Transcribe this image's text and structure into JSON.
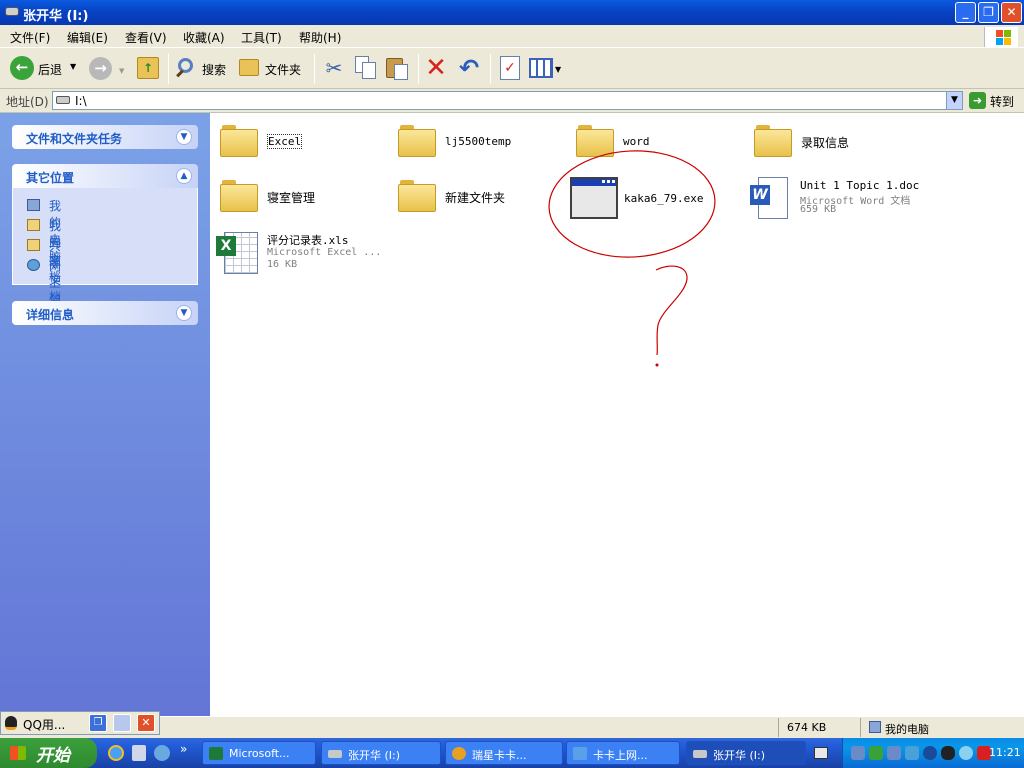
{
  "window": {
    "title": "张开华 (I:)"
  },
  "menu": [
    "文件(F)",
    "编辑(E)",
    "查看(V)",
    "收藏(A)",
    "工具(T)",
    "帮助(H)"
  ],
  "toolbar": {
    "back": "后退",
    "search": "搜索",
    "folders": "文件夹"
  },
  "address": {
    "label": "地址(D)",
    "value": "I:\\",
    "go": "转到"
  },
  "sidebar": {
    "tasks_title": "文件和文件夹任务",
    "other_title": "其它位置",
    "other_items": [
      "我的电脑",
      "我的文档",
      "共享文档",
      "网上邻居"
    ],
    "details_title": "详细信息"
  },
  "files": [
    {
      "name": "Excel",
      "type": "folder"
    },
    {
      "name": "lj5500temp",
      "type": "folder"
    },
    {
      "name": "word",
      "type": "folder"
    },
    {
      "name": "录取信息",
      "type": "folder"
    },
    {
      "name": "寝室管理",
      "type": "folder"
    },
    {
      "name": "新建文件夹",
      "type": "folder"
    },
    {
      "name": "kaka6_79.exe",
      "type": "exe"
    },
    {
      "name": "Unit 1 Topic 1.doc",
      "type": "doc",
      "desc": "Microsoft Word 文档",
      "size": "659 KB"
    },
    {
      "name": "评分记录表.xls",
      "type": "xls",
      "desc": "Microsoft Excel ...",
      "size": "16 KB"
    }
  ],
  "annotation": {
    "mark": "?",
    "color": "#cc0000"
  },
  "status": {
    "size": "674 KB",
    "location": "我的电脑"
  },
  "qq": {
    "label": "QQ用..."
  },
  "taskbar": {
    "start": "开始",
    "tasks": [
      "Microsoft...",
      "张开华 (I:)",
      "瑞星卡卡...",
      "卡卡上网...",
      "张开华 (I:)"
    ],
    "clock": "11:21"
  }
}
